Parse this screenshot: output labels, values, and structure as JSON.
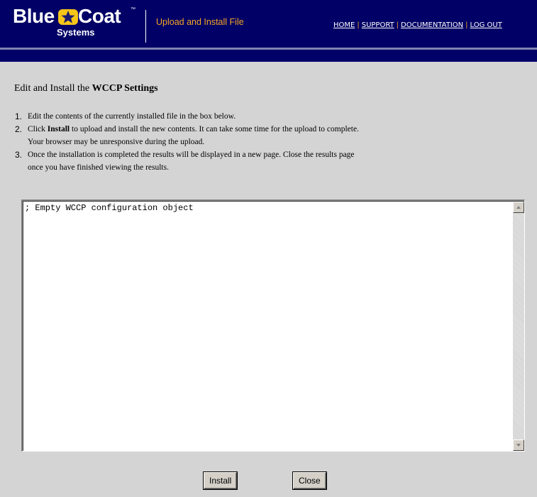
{
  "header": {
    "brand": {
      "word_left": "Blue",
      "word_right": "Coat",
      "trademark": "™",
      "subtitle": "Systems"
    },
    "page_title": "Upload and Install File",
    "nav": {
      "home": "HOME",
      "support": "SUPPORT",
      "documentation": "DOCUMENTATION",
      "logout": "LOG OUT",
      "separator": "|"
    },
    "colors": {
      "navy": "#000066",
      "accent": "#f5a623"
    }
  },
  "content": {
    "heading_prefix": "Edit and Install the",
    "heading_bold": "WCCP Settings",
    "steps": [
      {
        "num": "1.",
        "text": "Edit the contents of the currently installed file in the box below."
      },
      {
        "num": "2.",
        "text_prefix": "Click",
        "text_bold": "Install",
        "text_suffix": "to upload and install the new contents. It can take some time for the upload to complete.",
        "text_line2": "Your browser may be unresponsive during the upload."
      },
      {
        "num": "3.",
        "text": "Once the installation is completed the results will be displayed in a new page. Close the results page",
        "text_line2": "once you have finished viewing the results."
      }
    ],
    "editor_value": "; Empty WCCP configuration object"
  },
  "buttons": {
    "install": "Install",
    "close": "Close"
  }
}
